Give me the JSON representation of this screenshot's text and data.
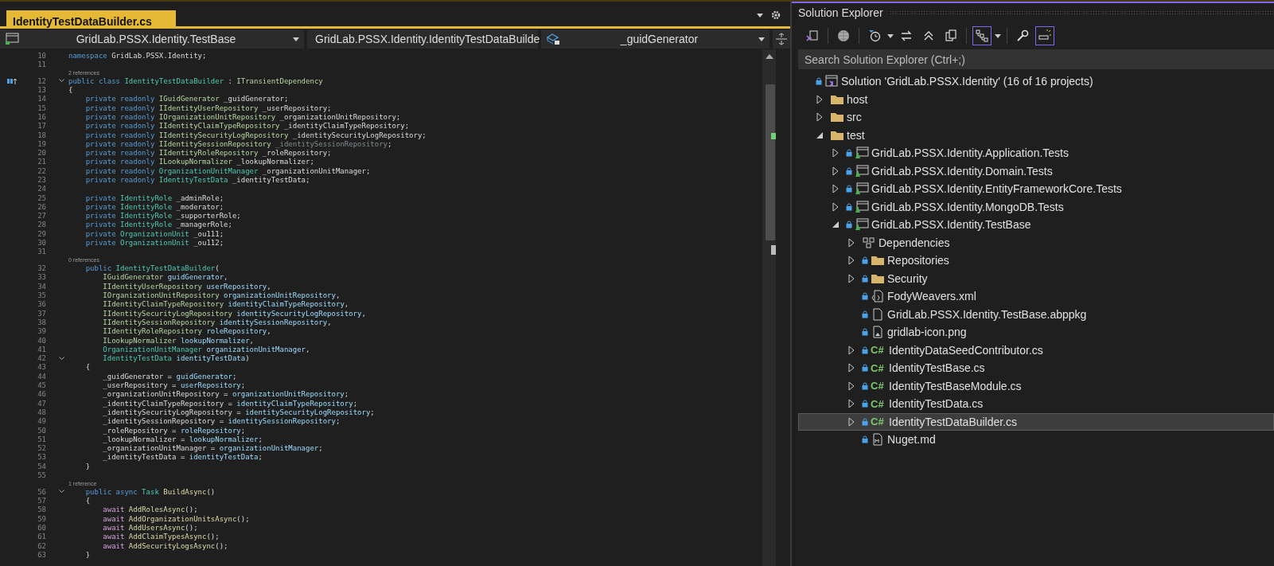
{
  "editor": {
    "tabs": [
      {
        "label": "IdentityTestDataBuilder.cs",
        "selected": true
      }
    ],
    "nav_bar": [
      {
        "kind": "project",
        "label": "GridLab.PSSX.Identity.TestBase"
      },
      {
        "kind": "class",
        "label": "GridLab.PSSX.Identity.IdentityTestDataBuilde"
      },
      {
        "kind": "field",
        "label": "_guidGenerator"
      }
    ],
    "lines": [
      {
        "kind": "code",
        "number": "10",
        "foldable": false,
        "tokens": [
          {
            "kind": "keyword",
            "text": "namespace"
          },
          {
            "kind": "plain",
            "text": " GridLab.PSSX.Identity;"
          }
        ]
      },
      {
        "kind": "code",
        "number": "11",
        "foldable": false
      },
      {
        "kind": "codelens",
        "text": "2 references"
      },
      {
        "kind": "declaration",
        "number": "12",
        "foldable": true,
        "tokens": [
          {
            "kind": "keyword",
            "text": "public class"
          },
          {
            "kind": "type",
            "text": " IdentityTestDataBuilder"
          },
          {
            "kind": "plain",
            "text": " : "
          },
          {
            "kind": "interface",
            "text": "ITransientDependency"
          }
        ]
      },
      {
        "kind": "code",
        "number": "13",
        "foldable": false,
        "tokens": [
          {
            "kind": "plain",
            "text": "{"
          }
        ]
      },
      {
        "kind": "code",
        "number": "14",
        "foldable": false,
        "tokens": [
          {
            "kind": "keyword",
            "text": "    private readonly"
          },
          {
            "kind": "interface",
            "text": " IGuidGenerator"
          },
          {
            "kind": "plain",
            "text": " _guidGenerator;"
          }
        ]
      },
      {
        "kind": "code",
        "number": "15",
        "foldable": false,
        "tokens": [
          {
            "kind": "keyword",
            "text": "    private readonly"
          },
          {
            "kind": "interface",
            "text": " IIdentityUserRepository"
          },
          {
            "kind": "plain",
            "text": " _userRepository;"
          }
        ]
      },
      {
        "kind": "code",
        "number": "16",
        "foldable": false,
        "tokens": [
          {
            "kind": "keyword",
            "text": "    private readonly"
          },
          {
            "kind": "interface",
            "text": " IOrganizationUnitRepository"
          },
          {
            "kind": "plain",
            "text": " _organizationUnitRepository;"
          }
        ]
      },
      {
        "kind": "code",
        "number": "17",
        "foldable": false,
        "tokens": [
          {
            "kind": "keyword",
            "text": "    private readonly"
          },
          {
            "kind": "interface",
            "text": " IIdentityClaimTypeRepository"
          },
          {
            "kind": "plain",
            "text": " _identityClaimTypeRepository;"
          }
        ]
      },
      {
        "kind": "code",
        "number": "18",
        "foldable": false,
        "tokens": [
          {
            "kind": "keyword",
            "text": "    private readonly"
          },
          {
            "kind": "interface",
            "text": " IIdentitySecurityLogRepository"
          },
          {
            "kind": "plain",
            "text": " _identitySecurityLogRepository;"
          }
        ]
      },
      {
        "kind": "code",
        "number": "19",
        "foldable": false,
        "tokens": [
          {
            "kind": "keyword",
            "text": "    private readonly"
          },
          {
            "kind": "interface",
            "text": " IIdentitySessionRepository"
          },
          {
            "kind": "unused",
            "text": " _identitySessionRepository"
          },
          {
            "kind": "plain",
            "text": ";"
          }
        ]
      },
      {
        "kind": "code",
        "number": "20",
        "foldable": false,
        "tokens": [
          {
            "kind": "keyword",
            "text": "    private readonly"
          },
          {
            "kind": "interface",
            "text": " IIdentityRoleRepository"
          },
          {
            "kind": "plain",
            "text": " _roleRepository;"
          }
        ]
      },
      {
        "kind": "code",
        "number": "21",
        "foldable": false,
        "tokens": [
          {
            "kind": "keyword",
            "text": "    private readonly"
          },
          {
            "kind": "interface",
            "text": " ILookupNormalizer"
          },
          {
            "kind": "plain",
            "text": " _lookupNormalizer;"
          }
        ]
      },
      {
        "kind": "code",
        "number": "22",
        "foldable": false,
        "tokens": [
          {
            "kind": "keyword",
            "text": "    private readonly"
          },
          {
            "kind": "type",
            "text": " OrganizationUnitManager"
          },
          {
            "kind": "plain",
            "text": " _organizationUnitManager;"
          }
        ]
      },
      {
        "kind": "code",
        "number": "23",
        "foldable": false,
        "tokens": [
          {
            "kind": "keyword",
            "text": "    private readonly"
          },
          {
            "kind": "type",
            "text": " IdentityTestData"
          },
          {
            "kind": "plain",
            "text": " _identityTestData;"
          }
        ]
      },
      {
        "kind": "code",
        "number": "24",
        "foldable": false
      },
      {
        "kind": "code",
        "number": "25",
        "foldable": false,
        "tokens": [
          {
            "kind": "keyword",
            "text": "    private"
          },
          {
            "kind": "type",
            "text": " IdentityRole"
          },
          {
            "kind": "plain",
            "text": " _adminRole;"
          }
        ]
      },
      {
        "kind": "code",
        "number": "26",
        "foldable": false,
        "tokens": [
          {
            "kind": "keyword",
            "text": "    private"
          },
          {
            "kind": "type",
            "text": " IdentityRole"
          },
          {
            "kind": "plain",
            "text": " _moderator;"
          }
        ]
      },
      {
        "kind": "code",
        "number": "27",
        "foldable": false,
        "tokens": [
          {
            "kind": "keyword",
            "text": "    private"
          },
          {
            "kind": "type",
            "text": " IdentityRole"
          },
          {
            "kind": "plain",
            "text": " _supporterRole;"
          }
        ]
      },
      {
        "kind": "code",
        "number": "28",
        "foldable": false,
        "tokens": [
          {
            "kind": "keyword",
            "text": "    private"
          },
          {
            "kind": "type",
            "text": " IdentityRole"
          },
          {
            "kind": "plain",
            "text": " _managerRole;"
          }
        ]
      },
      {
        "kind": "code",
        "number": "29",
        "foldable": false,
        "tokens": [
          {
            "kind": "keyword",
            "text": "    private"
          },
          {
            "kind": "type",
            "text": " OrganizationUnit"
          },
          {
            "kind": "plain",
            "text": " _ou111;"
          }
        ]
      },
      {
        "kind": "code",
        "number": "30",
        "foldable": false,
        "tokens": [
          {
            "kind": "keyword",
            "text": "    private"
          },
          {
            "kind": "type",
            "text": " OrganizationUnit"
          },
          {
            "kind": "plain",
            "text": " _ou112;"
          }
        ]
      },
      {
        "kind": "code",
        "number": "31",
        "foldable": false
      },
      {
        "kind": "codelens",
        "text": "0 references"
      },
      {
        "kind": "code",
        "number": "32",
        "foldable": false,
        "tokens": [
          {
            "kind": "keyword",
            "text": "    public"
          },
          {
            "kind": "type",
            "text": " IdentityTestDataBuilder"
          },
          {
            "kind": "plain",
            "text": "("
          }
        ]
      },
      {
        "kind": "code",
        "number": "33",
        "foldable": false,
        "tokens": [
          {
            "kind": "interface",
            "text": "        IGuidGenerator"
          },
          {
            "kind": "param",
            "text": " guidGenerator"
          },
          {
            "kind": "plain",
            "text": ","
          }
        ]
      },
      {
        "kind": "code",
        "number": "34",
        "foldable": false,
        "tokens": [
          {
            "kind": "interface",
            "text": "        IIdentityUserRepository"
          },
          {
            "kind": "param",
            "text": " userRepository"
          },
          {
            "kind": "plain",
            "text": ","
          }
        ]
      },
      {
        "kind": "code",
        "number": "35",
        "foldable": false,
        "tokens": [
          {
            "kind": "interface",
            "text": "        IOrganizationUnitRepository"
          },
          {
            "kind": "param",
            "text": " organizationUnitRepository"
          },
          {
            "kind": "plain",
            "text": ","
          }
        ]
      },
      {
        "kind": "code",
        "number": "36",
        "foldable": false,
        "tokens": [
          {
            "kind": "interface",
            "text": "        IIdentityClaimTypeRepository"
          },
          {
            "kind": "param",
            "text": " identityClaimTypeRepository"
          },
          {
            "kind": "plain",
            "text": ","
          }
        ]
      },
      {
        "kind": "code",
        "number": "37",
        "foldable": false,
        "tokens": [
          {
            "kind": "interface",
            "text": "        IIdentitySecurityLogRepository"
          },
          {
            "kind": "param",
            "text": " identitySecurityLogRepository"
          },
          {
            "kind": "plain",
            "text": ","
          }
        ]
      },
      {
        "kind": "code",
        "number": "38",
        "foldable": false,
        "tokens": [
          {
            "kind": "interface",
            "text": "        IIdentitySessionRepository"
          },
          {
            "kind": "param",
            "text": " identitySessionRepository"
          },
          {
            "kind": "plain",
            "text": ","
          }
        ]
      },
      {
        "kind": "code",
        "number": "39",
        "foldable": false,
        "tokens": [
          {
            "kind": "interface",
            "text": "        IIdentityRoleRepository"
          },
          {
            "kind": "param",
            "text": " roleRepository"
          },
          {
            "kind": "plain",
            "text": ","
          }
        ]
      },
      {
        "kind": "code",
        "number": "40",
        "foldable": false,
        "tokens": [
          {
            "kind": "interface",
            "text": "        ILookupNormalizer"
          },
          {
            "kind": "param",
            "text": " lookupNormalizer"
          },
          {
            "kind": "plain",
            "text": ","
          }
        ]
      },
      {
        "kind": "code",
        "number": "41",
        "foldable": false,
        "tokens": [
          {
            "kind": "type",
            "text": "        OrganizationUnitManager"
          },
          {
            "kind": "param",
            "text": " organizationUnitManager"
          },
          {
            "kind": "plain",
            "text": ","
          }
        ]
      },
      {
        "kind": "code",
        "number": "42",
        "foldable": true,
        "tokens": [
          {
            "kind": "type",
            "text": "        IdentityTestData"
          },
          {
            "kind": "param",
            "text": " identityTestData"
          },
          {
            "kind": "plain",
            "text": ")"
          }
        ]
      },
      {
        "kind": "code",
        "number": "43",
        "foldable": false,
        "tokens": [
          {
            "kind": "plain",
            "text": "    {"
          }
        ]
      },
      {
        "kind": "code",
        "number": "44",
        "foldable": false,
        "tokens": [
          {
            "kind": "plain",
            "text": "        _guidGenerator = "
          },
          {
            "kind": "param",
            "text": "guidGenerator"
          },
          {
            "kind": "plain",
            "text": ";"
          }
        ]
      },
      {
        "kind": "code",
        "number": "45",
        "foldable": false,
        "tokens": [
          {
            "kind": "plain",
            "text": "        _userRepository = "
          },
          {
            "kind": "param",
            "text": "userRepository"
          },
          {
            "kind": "plain",
            "text": ";"
          }
        ]
      },
      {
        "kind": "code",
        "number": "46",
        "foldable": false,
        "tokens": [
          {
            "kind": "plain",
            "text": "        _organizationUnitRepository = "
          },
          {
            "kind": "param",
            "text": "organizationUnitRepository"
          },
          {
            "kind": "plain",
            "text": ";"
          }
        ]
      },
      {
        "kind": "code",
        "number": "47",
        "foldable": false,
        "tokens": [
          {
            "kind": "plain",
            "text": "        _identityClaimTypeRepository = "
          },
          {
            "kind": "param",
            "text": "identityClaimTypeRepository"
          },
          {
            "kind": "plain",
            "text": ";"
          }
        ]
      },
      {
        "kind": "code",
        "number": "48",
        "foldable": false,
        "tokens": [
          {
            "kind": "plain",
            "text": "        _identitySecurityLogRepository = "
          },
          {
            "kind": "param",
            "text": "identitySecurityLogRepository"
          },
          {
            "kind": "plain",
            "text": ";"
          }
        ]
      },
      {
        "kind": "code",
        "number": "49",
        "foldable": false,
        "tokens": [
          {
            "kind": "plain",
            "text": "        _identitySessionRepository = "
          },
          {
            "kind": "param",
            "text": "identitySessionRepository"
          },
          {
            "kind": "plain",
            "text": ";"
          }
        ]
      },
      {
        "kind": "code",
        "number": "50",
        "foldable": false,
        "tokens": [
          {
            "kind": "plain",
            "text": "        _roleRepository = "
          },
          {
            "kind": "param",
            "text": "roleRepository"
          },
          {
            "kind": "plain",
            "text": ";"
          }
        ]
      },
      {
        "kind": "code",
        "number": "51",
        "foldable": false,
        "tokens": [
          {
            "kind": "plain",
            "text": "        _lookupNormalizer = "
          },
          {
            "kind": "param",
            "text": "lookupNormalizer"
          },
          {
            "kind": "plain",
            "text": ";"
          }
        ]
      },
      {
        "kind": "code",
        "number": "52",
        "foldable": false,
        "tokens": [
          {
            "kind": "plain",
            "text": "        _organizationUnitManager = "
          },
          {
            "kind": "param",
            "text": "organizationUnitManager"
          },
          {
            "kind": "plain",
            "text": ";"
          }
        ]
      },
      {
        "kind": "code",
        "number": "53",
        "foldable": false,
        "tokens": [
          {
            "kind": "plain",
            "text": "        _identityTestData = "
          },
          {
            "kind": "param",
            "text": "identityTestData"
          },
          {
            "kind": "plain",
            "text": ";"
          }
        ]
      },
      {
        "kind": "code",
        "number": "54",
        "foldable": false,
        "tokens": [
          {
            "kind": "plain",
            "text": "    }"
          }
        ]
      },
      {
        "kind": "code",
        "number": "55",
        "foldable": false
      },
      {
        "kind": "codelens",
        "text": "1 reference"
      },
      {
        "kind": "code",
        "number": "56",
        "foldable": true,
        "tokens": [
          {
            "kind": "keyword",
            "text": "    public async"
          },
          {
            "kind": "type",
            "text": " Task"
          },
          {
            "kind": "method",
            "text": " BuildAsync"
          },
          {
            "kind": "plain",
            "text": "()"
          }
        ]
      },
      {
        "kind": "code",
        "number": "57",
        "foldable": false,
        "tokens": [
          {
            "kind": "plain",
            "text": "    {"
          }
        ]
      },
      {
        "kind": "code",
        "number": "58",
        "foldable": false,
        "tokens": [
          {
            "kind": "control",
            "text": "        await"
          },
          {
            "kind": "method",
            "text": " AddRolesAsync"
          },
          {
            "kind": "plain",
            "text": "();"
          }
        ]
      },
      {
        "kind": "code",
        "number": "59",
        "foldable": false,
        "tokens": [
          {
            "kind": "control",
            "text": "        await"
          },
          {
            "kind": "method",
            "text": " AddOrganizationUnitsAsync"
          },
          {
            "kind": "plain",
            "text": "();"
          }
        ]
      },
      {
        "kind": "code",
        "number": "60",
        "foldable": false,
        "tokens": [
          {
            "kind": "control",
            "text": "        await"
          },
          {
            "kind": "method",
            "text": " AddUsersAsync"
          },
          {
            "kind": "plain",
            "text": "();"
          }
        ]
      },
      {
        "kind": "code",
        "number": "61",
        "foldable": false,
        "tokens": [
          {
            "kind": "control",
            "text": "        await"
          },
          {
            "kind": "method",
            "text": " AddClaimTypesAsync"
          },
          {
            "kind": "plain",
            "text": "();"
          }
        ]
      },
      {
        "kind": "code",
        "number": "62",
        "foldable": false,
        "tokens": [
          {
            "kind": "control",
            "text": "        await"
          },
          {
            "kind": "method",
            "text": " AddSecurityLogsAsync"
          },
          {
            "kind": "plain",
            "text": "();"
          }
        ]
      },
      {
        "kind": "code",
        "number": "63",
        "foldable": false,
        "tokens": [
          {
            "kind": "plain",
            "text": "    }"
          }
        ]
      }
    ]
  },
  "solution_explorer": {
    "title": "Solution Explorer",
    "toolbar": [
      {
        "kind": "switch-views",
        "on": false
      },
      {
        "kind": "separator"
      },
      {
        "kind": "globe",
        "on": false
      },
      {
        "kind": "separator"
      },
      {
        "kind": "pending-filter",
        "on": false
      },
      {
        "kind": "dropdown"
      },
      {
        "kind": "sync",
        "on": false
      },
      {
        "kind": "collapse",
        "on": false
      },
      {
        "kind": "copy",
        "on": false
      },
      {
        "kind": "separator"
      },
      {
        "kind": "tree-view",
        "on": true
      },
      {
        "kind": "dropdown"
      },
      {
        "kind": "separator"
      },
      {
        "kind": "properties",
        "on": false
      },
      {
        "kind": "preview",
        "on": true
      }
    ],
    "search": {
      "placeholder": "Search Solution Explorer (Ctrl+;)"
    },
    "tree": [
      {
        "label": "Solution 'GridLab.PSSX.Identity' (16 of 16 projects)",
        "kind": "solution",
        "locked": true,
        "selected": false,
        "children": [
          {
            "label": "host",
            "kind": "folder",
            "locked": false,
            "selected": false,
            "expanded": false
          },
          {
            "label": "src",
            "kind": "folder",
            "locked": false,
            "selected": false,
            "expanded": false
          },
          {
            "label": "test",
            "kind": "folder",
            "locked": false,
            "selected": false,
            "expanded": true,
            "children": [
              {
                "label": "GridLab.PSSX.Identity.Application.Tests",
                "kind": "test-project",
                "locked": true,
                "selected": false,
                "expanded": false
              },
              {
                "label": "GridLab.PSSX.Identity.Domain.Tests",
                "kind": "test-project",
                "locked": true,
                "selected": false,
                "expanded": false
              },
              {
                "label": "GridLab.PSSX.Identity.EntityFrameworkCore.Tests",
                "kind": "test-project",
                "locked": true,
                "selected": false,
                "expanded": false
              },
              {
                "label": "GridLab.PSSX.Identity.MongoDB.Tests",
                "kind": "test-project",
                "locked": true,
                "selected": false,
                "expanded": false
              },
              {
                "label": "GridLab.PSSX.Identity.TestBase",
                "kind": "test-project",
                "locked": true,
                "selected": false,
                "expanded": true,
                "children": [
                  {
                    "label": "Dependencies",
                    "kind": "dependencies",
                    "locked": false,
                    "selected": false,
                    "expanded": false
                  },
                  {
                    "label": "Repositories",
                    "kind": "folder",
                    "locked": true,
                    "selected": false,
                    "expanded": false
                  },
                  {
                    "label": "Security",
                    "kind": "folder",
                    "locked": true,
                    "selected": false,
                    "expanded": false
                  },
                  {
                    "label": "FodyWeavers.xml",
                    "kind": "xml-file",
                    "locked": true,
                    "selected": false
                  },
                  {
                    "label": "GridLab.PSSX.Identity.TestBase.abppkg",
                    "kind": "file",
                    "locked": true,
                    "selected": false
                  },
                  {
                    "label": "gridlab-icon.png",
                    "kind": "image-file",
                    "locked": true,
                    "selected": false
                  },
                  {
                    "label": "IdentityDataSeedContributor.cs",
                    "kind": "csharp",
                    "icon_text": "C#",
                    "locked": true,
                    "selected": false,
                    "expanded": false
                  },
                  {
                    "label": "IdentityTestBase.cs",
                    "kind": "csharp",
                    "icon_text": "C#",
                    "locked": true,
                    "selected": false,
                    "expanded": false
                  },
                  {
                    "label": "IdentityTestBaseModule.cs",
                    "kind": "csharp",
                    "icon_text": "C#",
                    "locked": true,
                    "selected": false,
                    "expanded": false
                  },
                  {
                    "label": "IdentityTestData.cs",
                    "kind": "csharp",
                    "icon_text": "C#",
                    "locked": true,
                    "selected": false,
                    "expanded": false
                  },
                  {
                    "label": "IdentityTestDataBuilder.cs",
                    "kind": "csharp",
                    "icon_text": "C#",
                    "locked": true,
                    "selected": true,
                    "expanded": false
                  },
                  {
                    "label": "Nuget.md",
                    "kind": "markdown-file",
                    "locked": true,
                    "selected": false
                  }
                ]
              }
            ]
          }
        ]
      }
    ]
  }
}
